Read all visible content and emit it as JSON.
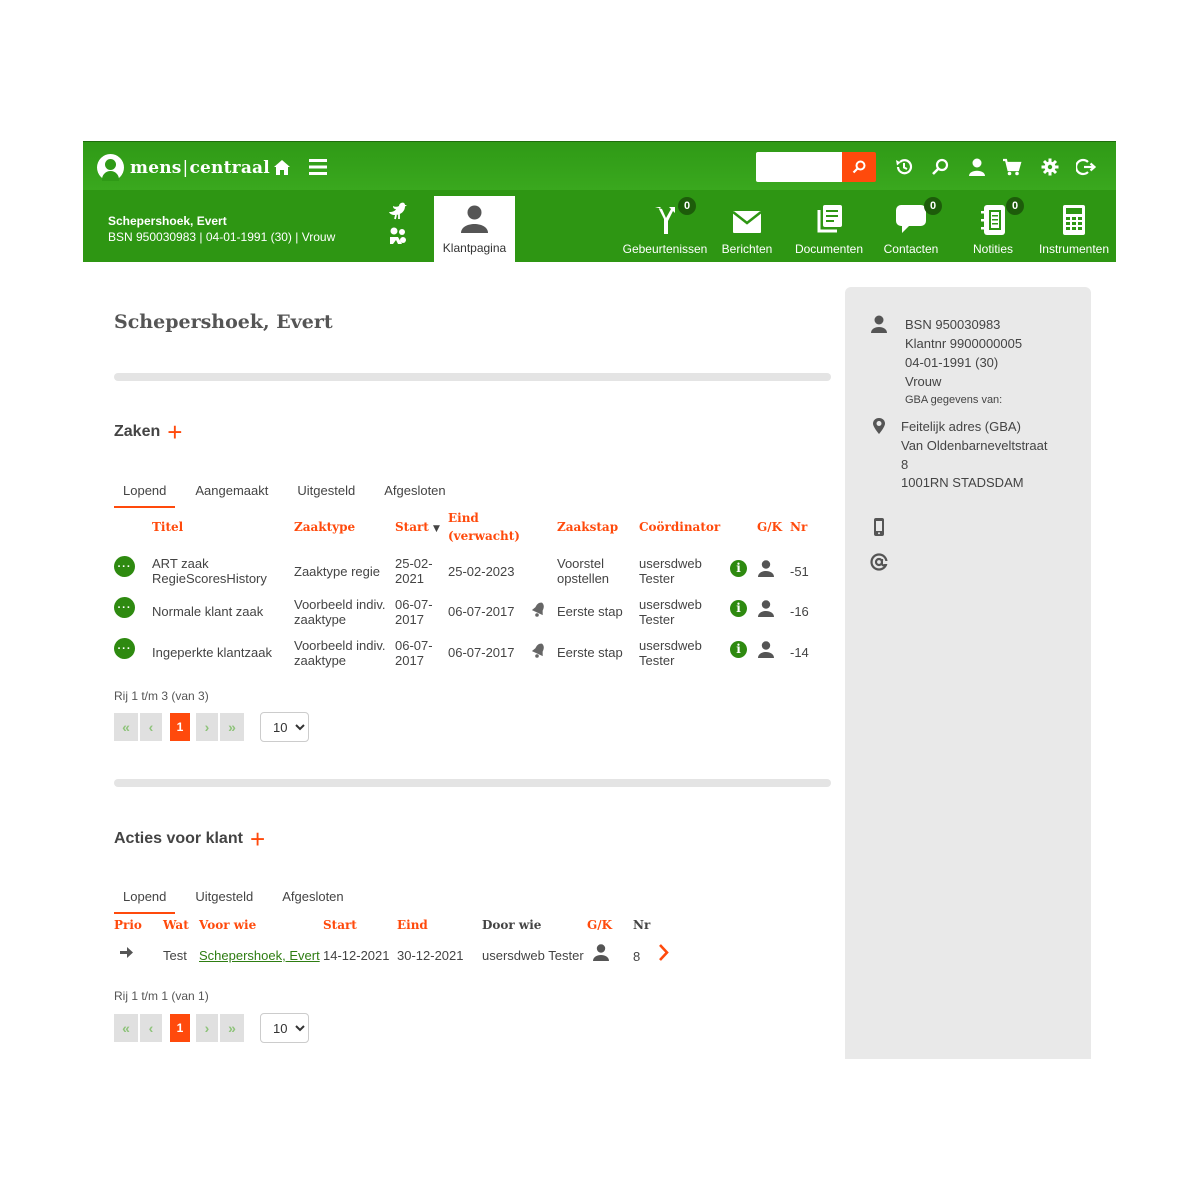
{
  "app": {
    "logo_left": "mens",
    "logo_sep": "|",
    "logo_right": "centraal"
  },
  "topbar": {
    "icons": [
      "home-icon",
      "menu-icon",
      "history-icon",
      "search-icon",
      "user-icon",
      "cart-icon",
      "gear-icon",
      "logout-icon"
    ],
    "search_placeholder": ""
  },
  "client": {
    "name": "Schepershoek, Evert",
    "info": "BSN 950030983 | 04-01-1991 (30) | Vrouw"
  },
  "nav": {
    "klantpagina": "Klantpagina",
    "gebeurtenissen": {
      "label": "Gebeurtenissen",
      "count": "0"
    },
    "berichten": {
      "label": "Berichten"
    },
    "documenten": {
      "label": "Documenten"
    },
    "contacten": {
      "label": "Contacten",
      "count": "0"
    },
    "notities": {
      "label": "Notities",
      "count": "0"
    },
    "instrumenten": {
      "label": "Instrumenten"
    }
  },
  "main": {
    "title": "Schepershoek, Evert",
    "zaken": {
      "title": "Zaken",
      "tabs": [
        "Lopend",
        "Aangemaakt",
        "Uitgesteld",
        "Afgesloten"
      ],
      "headers": {
        "titel": "Titel",
        "zaaktype": "Zaaktype",
        "start": "Start",
        "eind1": "Eind",
        "eind2": "(verwacht)",
        "zaakstap": "Zaakstap",
        "coordinator": "Coördinator",
        "gk": "G/K",
        "nr": "Nr"
      },
      "rows": [
        {
          "titel1": "ART zaak",
          "titel2": "RegieScoresHistory",
          "zaaktype1": "Zaaktype regie",
          "zaaktype2": "",
          "start1": "25-02-",
          "start2": "2021",
          "eind": "25-02-2023",
          "zaakstap1": "Voorstel",
          "zaakstap2": "opstellen",
          "coord1": "usersdweb",
          "coord2": "Tester",
          "nr": "-51"
        },
        {
          "titel1": "Normale klant zaak",
          "titel2": "",
          "zaaktype1": "Voorbeeld indiv.",
          "zaaktype2": "zaaktype",
          "start1": "06-07-",
          "start2": "2017",
          "eind": "06-07-2017",
          "zaakstap1": "Eerste stap",
          "zaakstap2": "",
          "coord1": "usersdweb",
          "coord2": "Tester",
          "nr": "-16"
        },
        {
          "titel1": "Ingeperkte klantzaak",
          "titel2": "",
          "zaaktype1": "Voorbeeld indiv.",
          "zaaktype2": "zaaktype",
          "start1": "06-07-",
          "start2": "2017",
          "eind": "06-07-2017",
          "zaakstap1": "Eerste stap",
          "zaakstap2": "",
          "coord1": "usersdweb",
          "coord2": "Tester",
          "nr": "-14"
        }
      ],
      "pager_status": "Rij 1 t/m 3 (van 3)",
      "page": "1",
      "page_size": "10"
    },
    "acties": {
      "title": "Acties voor klant",
      "tabs": [
        "Lopend",
        "Uitgesteld",
        "Afgesloten"
      ],
      "headers": {
        "prio": "Prio",
        "wat": "Wat",
        "voorwie": "Voor wie",
        "start": "Start",
        "eind": "Eind",
        "doorwie": "Door wie",
        "gk": "G/K",
        "nr": "Nr"
      },
      "row": {
        "wat": "Test",
        "voorwie": "Schepershoek, Evert",
        "start": "14-12-2021",
        "eind": "30-12-2021",
        "doorwie": "usersdweb Tester",
        "nr": "8"
      },
      "pager_status": "Rij 1 t/m 1 (van 1)",
      "page": "1",
      "page_size": "10"
    }
  },
  "sidebar": {
    "bsn": "BSN 950030983",
    "klantnr": "Klantnr 9900000005",
    "dob": "04-01-1991 (30)",
    "gender": "Vrouw",
    "gba": "GBA gegevens van:",
    "adres_label": "Feitelijk adres (GBA)",
    "straat": "Van Oldenbarneveltstraat",
    "huisnummer": "8",
    "postcode": "1001RN STADSDAM"
  },
  "colors": {
    "primary_green": "#2e9613",
    "accent_orange": "#ff4a0c"
  }
}
